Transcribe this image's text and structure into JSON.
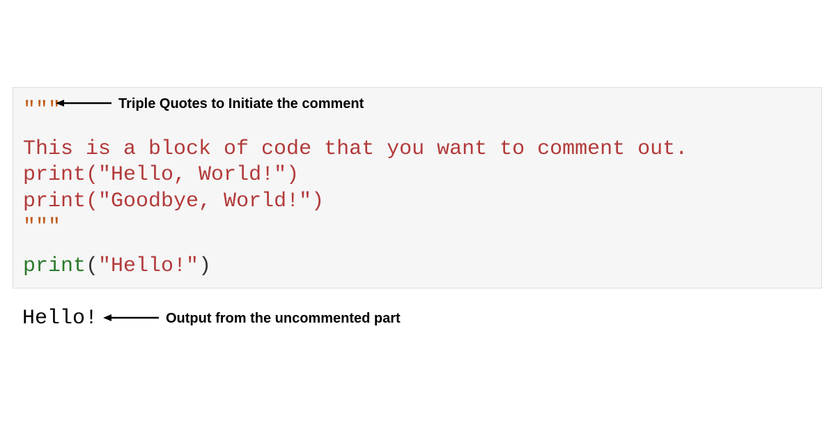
{
  "code": {
    "triple_open": "\"\"\"",
    "comment_line": "This is a block of code that you want to comment out.",
    "print1_func": "print",
    "print1_open": "(",
    "print1_arg": "\"Hello, World!\"",
    "print1_close": ")",
    "print2_func": "print",
    "print2_open": "(",
    "print2_arg": "\"Goodbye, World!\"",
    "print2_close": ")",
    "triple_close": "\"\"\"",
    "print3_func": "print",
    "print3_open": "(",
    "print3_arg": "\"Hello!\"",
    "print3_close": ")"
  },
  "output": {
    "text": "Hello!"
  },
  "annotations": {
    "top": "Triple Quotes to Initiate the comment",
    "bottom": "Output from the uncommented part"
  }
}
